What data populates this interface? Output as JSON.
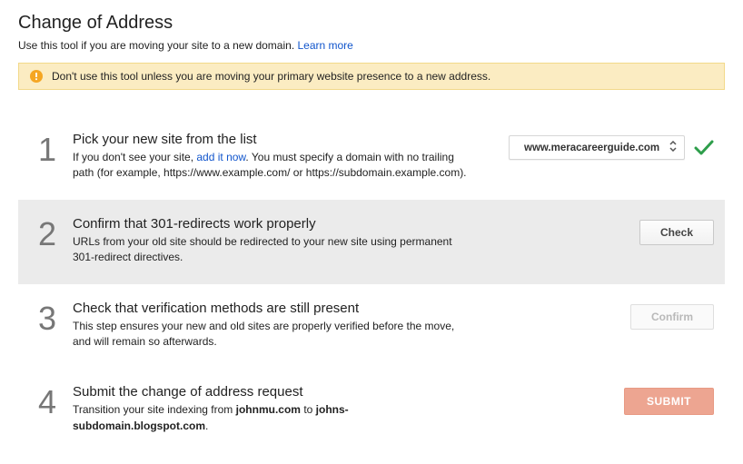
{
  "page": {
    "title": "Change of Address",
    "subtitle_prefix": "Use this tool if you are moving your site to a new domain. ",
    "learn_more": "Learn more"
  },
  "warning": {
    "text": "Don't use this tool unless you are moving your primary website presence to a new address."
  },
  "steps": {
    "s1": {
      "num": "1",
      "title": "Pick your new site from the list",
      "desc_before": "If you don't see your site, ",
      "add_link": "add it now",
      "desc_after": ". You must specify a domain with no trailing path (for example, https://www.example.com/ or https://subdomain.example.com)."
    },
    "s2": {
      "num": "2",
      "title": "Confirm that 301-redirects work properly",
      "desc": "URLs from your old site should be redirected to your new site using permanent 301-redirect directives."
    },
    "s3": {
      "num": "3",
      "title": "Check that verification methods are still present",
      "desc": "This step ensures your new and old sites are properly verified before the move, and will remain so afterwards."
    },
    "s4": {
      "num": "4",
      "title": "Submit the change of address request",
      "desc_prefix": "Transition your site indexing from ",
      "old_site": "johnmu.com",
      "desc_mid": " to ",
      "new_site": "johns-subdomain.blogspot.com",
      "desc_suffix": "."
    }
  },
  "actions": {
    "selected_site": "www.meracareerguide.com",
    "check_label": "Check",
    "confirm_label": "Confirm",
    "submit_label": "SUBMIT"
  }
}
